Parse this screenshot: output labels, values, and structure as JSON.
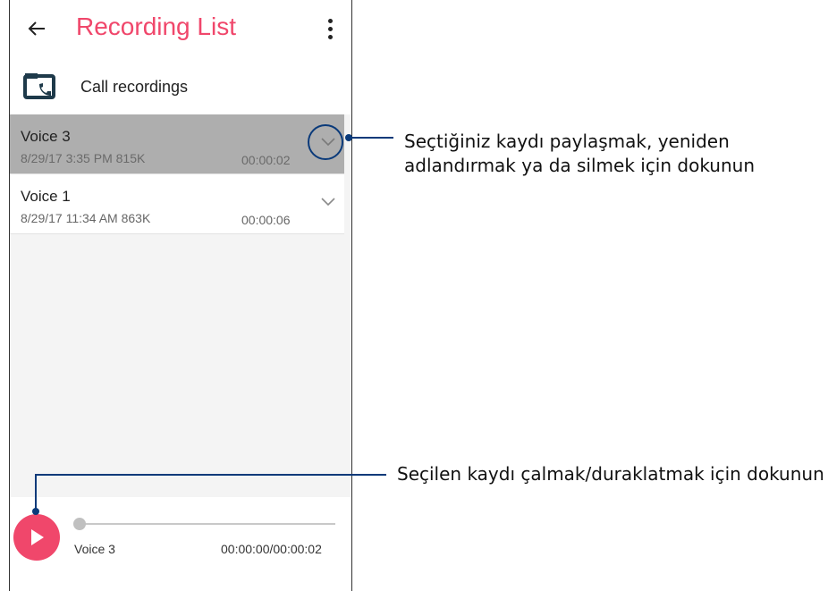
{
  "app_bar": {
    "back_icon": "arrow-left-icon",
    "title": "Recording List",
    "menu_icon": "more-vertical-icon",
    "accent_color": "#f0476b"
  },
  "call_recordings": {
    "icon": "call-recordings-folder-icon",
    "label": "Call recordings"
  },
  "recordings": [
    {
      "name": "Voice 3",
      "meta": "8/29/17 3:35 PM  815K",
      "duration": "00:00:02",
      "selected": true
    },
    {
      "name": "Voice 1",
      "meta": "8/29/17 11:34 AM  863K",
      "duration": "00:00:06",
      "selected": false
    }
  ],
  "player": {
    "play_icon": "play-icon",
    "current_name": "Voice 3",
    "time": "00:00:00/00:00:02",
    "progress": 0
  },
  "annotations": {
    "expand_callout": {
      "line1": "Seçtiğiniz kaydı paylaşmak, yeniden",
      "line2": "adlandırmak ya da silmek için dokunun"
    },
    "play_callout": "Seçilen kaydı çalmak/duraklatmak için dokunun",
    "callout_color": "#0a3a7a"
  }
}
